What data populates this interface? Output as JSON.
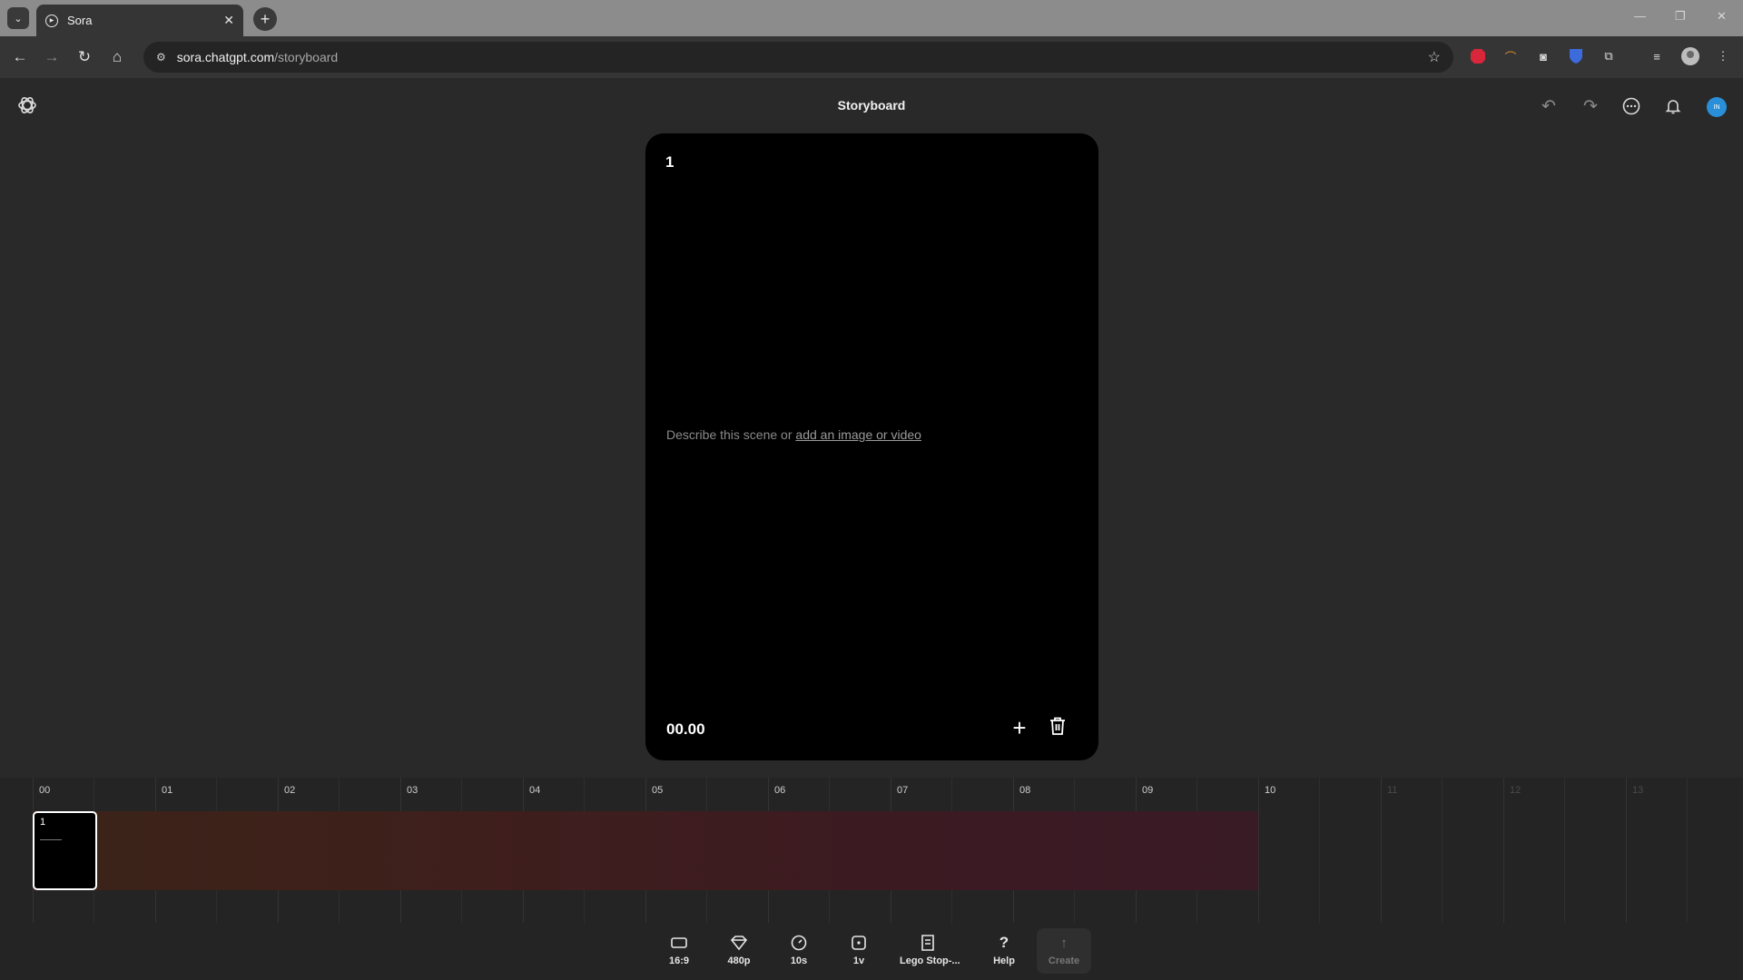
{
  "browser": {
    "tab_title": "Sora",
    "url_host": "sora.chatgpt.com",
    "url_path": "/storyboard"
  },
  "header": {
    "title": "Storyboard",
    "avatar_initials": "IN"
  },
  "scene": {
    "number": "1",
    "prompt_text": "Describe this scene or ",
    "prompt_link": "add an image or video",
    "timestamp": "00.00"
  },
  "timeline": {
    "ticks": [
      "00",
      "01",
      "02",
      "03",
      "04",
      "05",
      "06",
      "07",
      "08",
      "09",
      "10",
      "11",
      "12",
      "13"
    ],
    "clip_number": "1"
  },
  "toolbar": {
    "aspect_label": "16:9",
    "resolution_label": "480p",
    "duration_label": "10s",
    "variations_label": "1v",
    "preset_label": "Lego Stop-...",
    "help_label": "Help",
    "create_label": "Create"
  },
  "colors": {
    "background": "#292929",
    "card": "#000000",
    "avatar": "#2a8fd9"
  }
}
